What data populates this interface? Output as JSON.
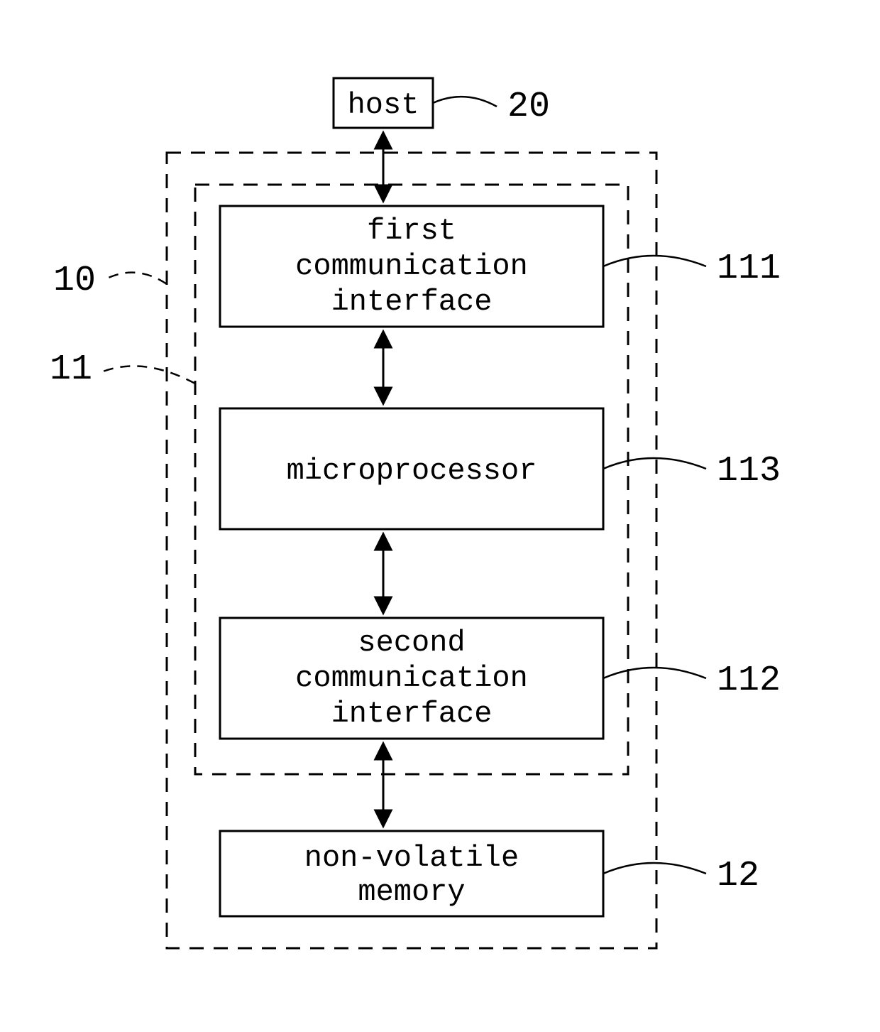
{
  "boxes": {
    "host": {
      "label": "host",
      "ref": "20"
    },
    "first_comm": {
      "line1": "first",
      "line2": "communication",
      "line3": "interface",
      "ref": "111"
    },
    "microprocessor": {
      "label": "microprocessor",
      "ref": "113"
    },
    "second_comm": {
      "line1": "second",
      "line2": "communication",
      "line3": "interface",
      "ref": "112"
    },
    "nv_memory": {
      "line1": "non-volatile",
      "line2": "memory",
      "ref": "12"
    }
  },
  "containers": {
    "outer": {
      "ref": "10"
    },
    "inner": {
      "ref": "11"
    }
  }
}
